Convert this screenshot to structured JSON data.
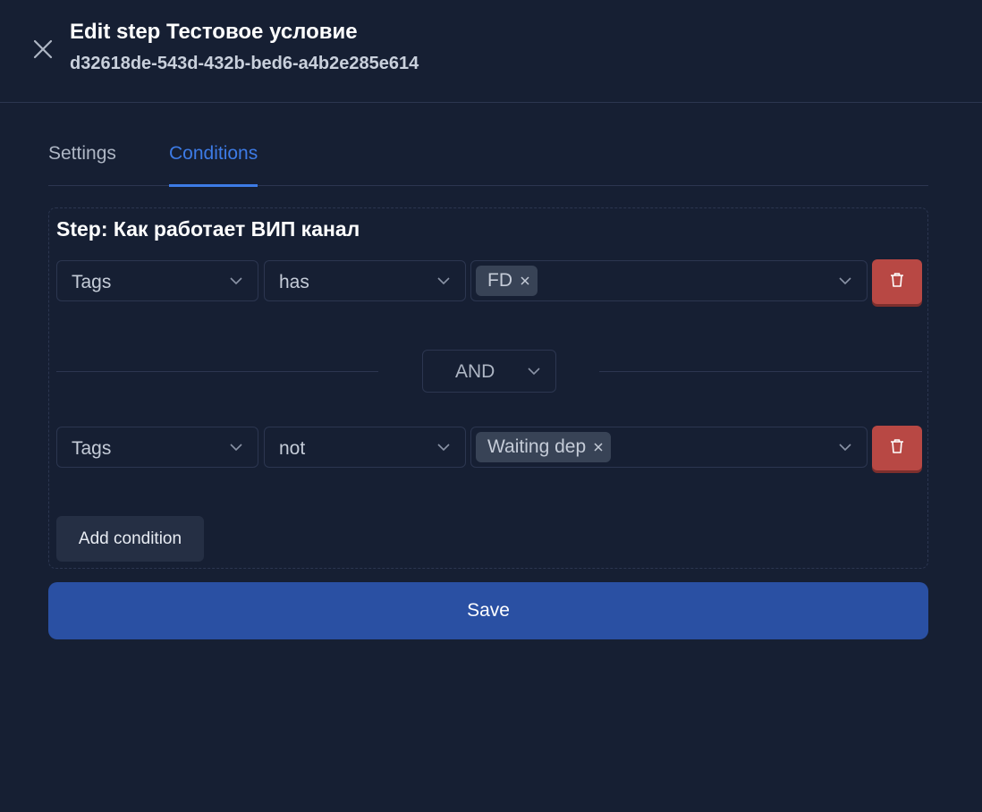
{
  "header": {
    "title": "Edit step Тестовое условие",
    "subtitle": "d32618de-543d-432b-bed6-a4b2e285e614",
    "close_icon": "close-icon"
  },
  "tabs": [
    {
      "label": "Settings",
      "active": false
    },
    {
      "label": "Conditions",
      "active": true
    }
  ],
  "step": {
    "title": "Step: Как работает ВИП канал"
  },
  "conditions": [
    {
      "field": "Tags",
      "operator": "has",
      "values": [
        "FD"
      ]
    },
    {
      "field": "Tags",
      "operator": "not",
      "values": [
        "Waiting dep"
      ]
    }
  ],
  "joiner": {
    "value": "AND"
  },
  "buttons": {
    "add_condition": "Add condition",
    "save": "Save"
  },
  "colors": {
    "background": "#161f33",
    "accent": "#3d7be6",
    "save_button": "#2a50a3",
    "delete_button": "#b84844"
  }
}
